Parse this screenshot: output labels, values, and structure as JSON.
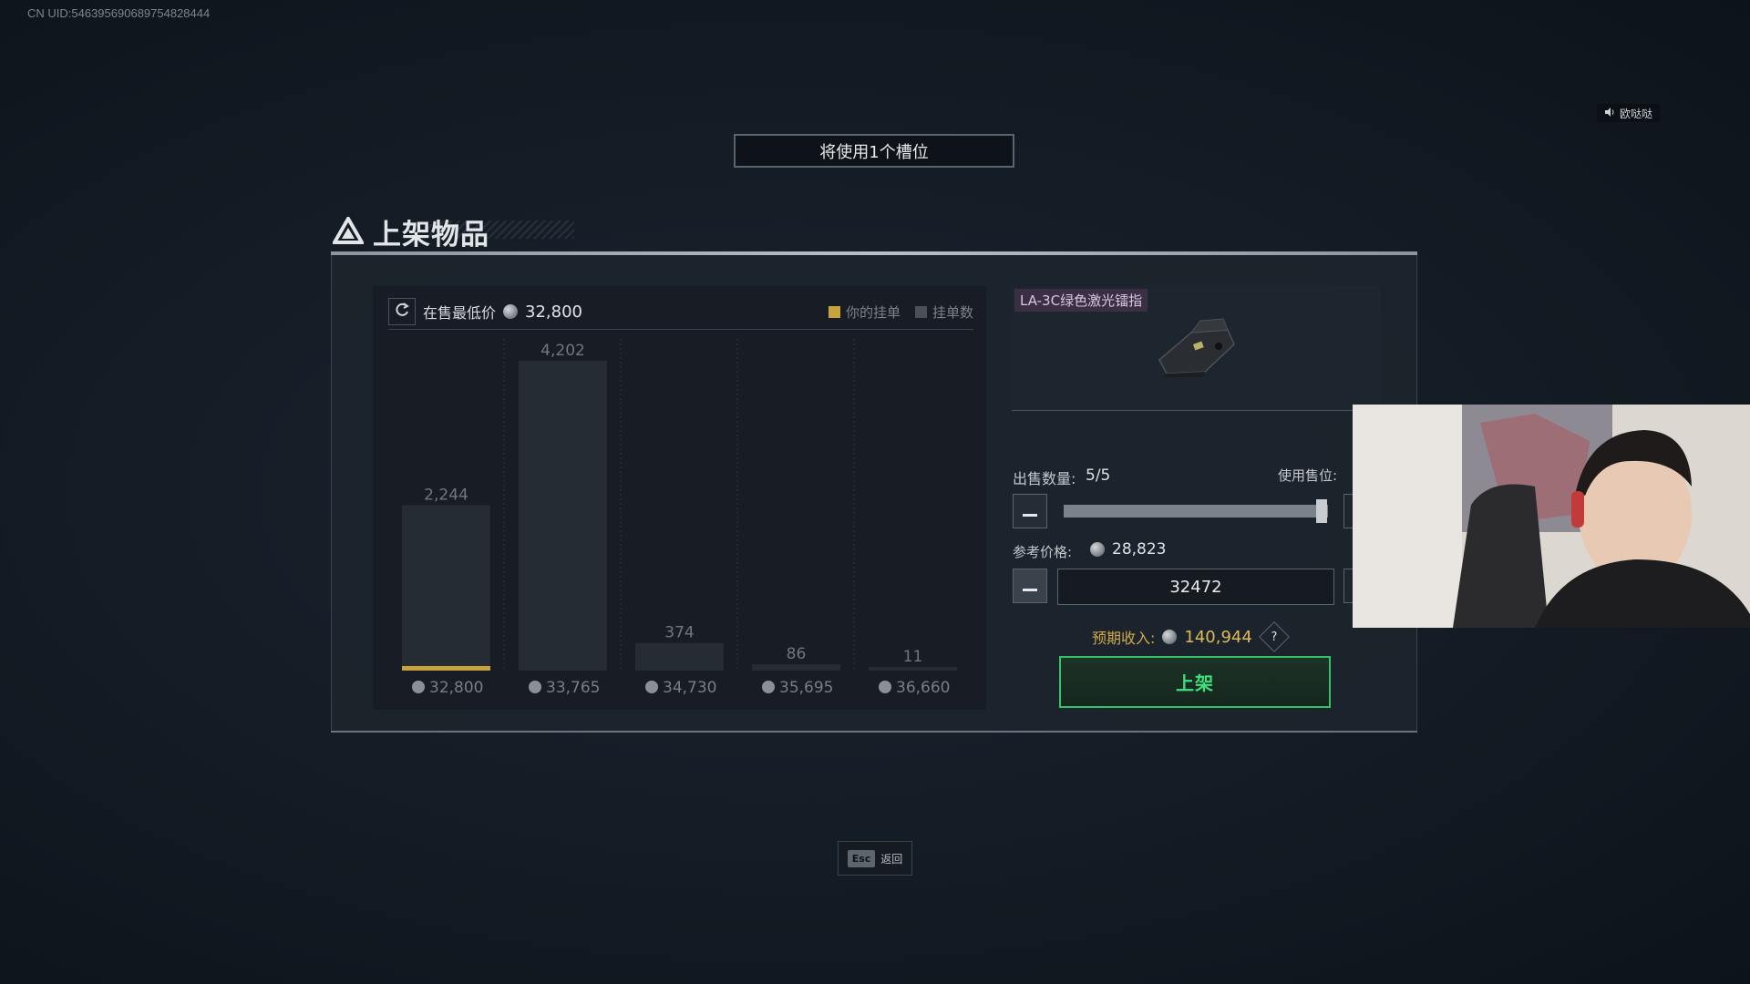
{
  "uid_text": "CN UID:546395690689754828444",
  "slot_hint": "将使用1个槽位",
  "sound_label": "欧哒哒",
  "panel_title": "上架物品",
  "market": {
    "lowest_label": "在售最低价",
    "lowest_value": "32,800",
    "legend_yours": "你的挂单",
    "legend_count": "挂单数"
  },
  "chart_data": {
    "type": "bar",
    "categories": [
      "32,800",
      "33,765",
      "34,730",
      "35,695",
      "36,660"
    ],
    "values": [
      2244,
      4202,
      374,
      86,
      11
    ],
    "value_labels": [
      "2,244",
      "4,202",
      "374",
      "86",
      "11"
    ],
    "your_listing_index": 0,
    "title": "",
    "xlabel": "",
    "ylabel": "",
    "series_colors": {
      "bar": "#262c33",
      "yours": "#c8a23c"
    }
  },
  "item": {
    "name": "LA-3C绿色激光镭指"
  },
  "sell": {
    "qty_label": "出售数量:",
    "qty_value": "5/5",
    "slot_label": "使用售位:",
    "qty_fraction": 1.0,
    "ref_label": "参考价格:",
    "ref_value": "28,823",
    "price_input": "32472",
    "income_label": "预期收入:",
    "income_value": "140,944",
    "help_symbol": "?",
    "list_button": "上架"
  },
  "footer": {
    "esc_key": "Esc",
    "esc_label": "返回"
  },
  "colors": {
    "accent_green": "#33c26a",
    "accent_gold": "#c8a23c",
    "item_tag": "#3b2f46"
  }
}
